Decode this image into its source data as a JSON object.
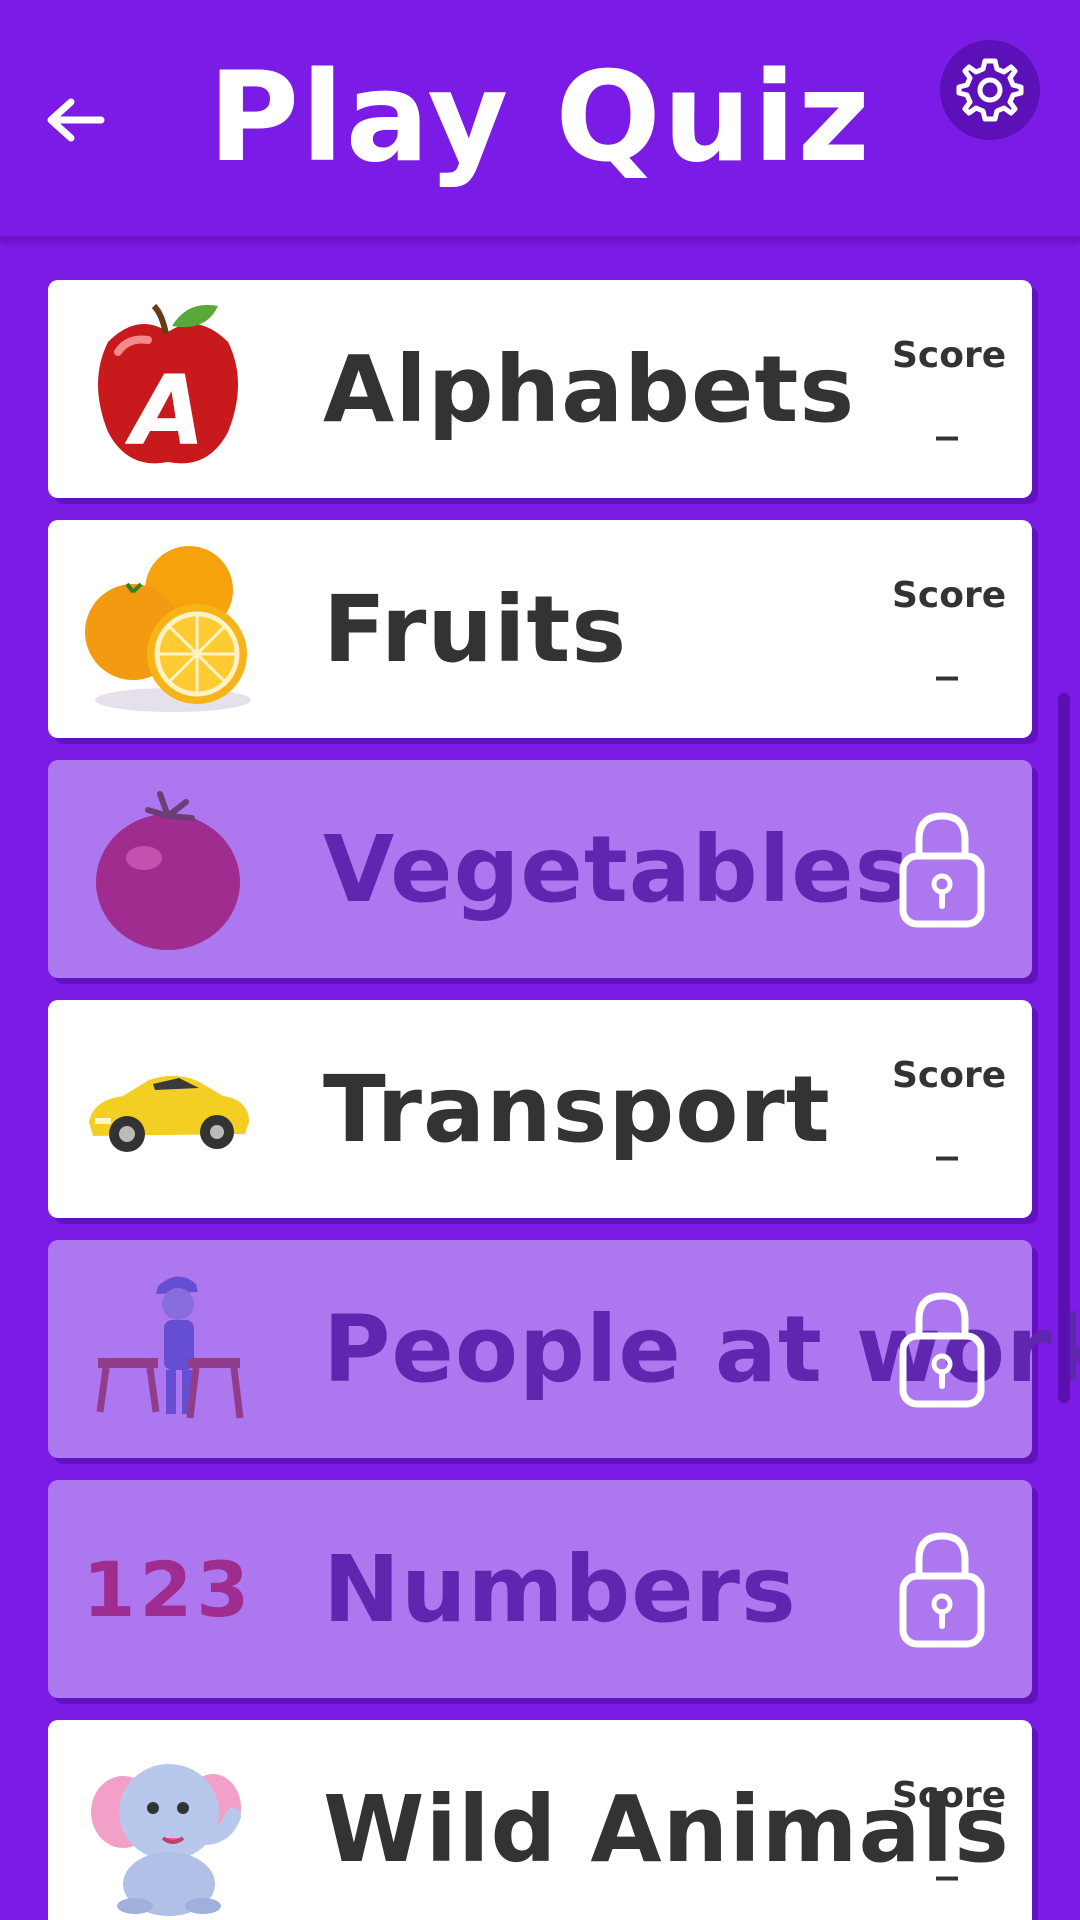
{
  "header": {
    "title": "Play Quiz",
    "back_icon": "arrow-left-icon",
    "settings_icon": "gear-icon"
  },
  "colors": {
    "background": "#7b1be6",
    "card": "#ffffff",
    "locked_card": "#ad78ef",
    "locked_text": "#5f26b0",
    "text": "#333333"
  },
  "quizzes": [
    {
      "label": "Alphabets",
      "locked": false,
      "score_label": "Score",
      "score_value": "_",
      "icon": "apple-letter-a-icon"
    },
    {
      "label": "Fruits",
      "locked": false,
      "score_label": "Score",
      "score_value": "_",
      "icon": "oranges-icon"
    },
    {
      "label": "Vegetables",
      "locked": true,
      "icon": "tomato-icon",
      "lock_icon": "lock-icon"
    },
    {
      "label": "Transport",
      "locked": false,
      "score_label": "Score",
      "score_value": "_",
      "icon": "car-icon"
    },
    {
      "label": "People at work",
      "locked": true,
      "icon": "carpenter-icon",
      "lock_icon": "lock-icon"
    },
    {
      "label": "Numbers",
      "locked": true,
      "thumb_text": "123",
      "icon": "numbers-icon",
      "lock_icon": "lock-icon"
    },
    {
      "label": "Wild Animals",
      "locked": false,
      "score_label": "Score",
      "score_value": "_",
      "icon": "elephant-icon"
    }
  ]
}
